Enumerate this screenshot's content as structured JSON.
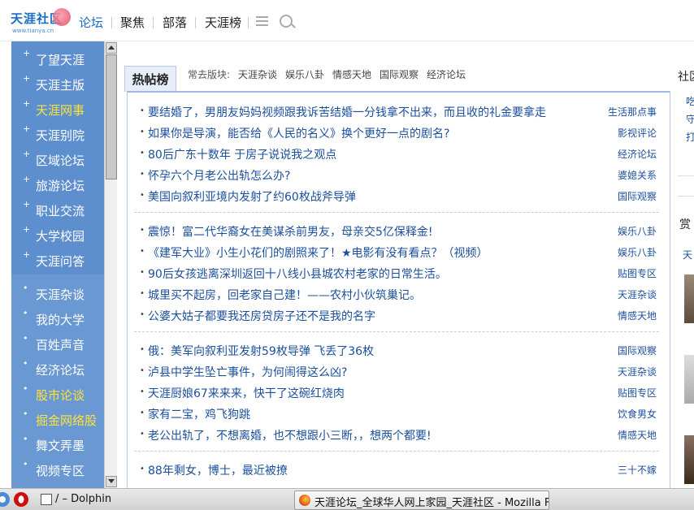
{
  "logo": {
    "text": "天涯社区",
    "url_text": "www.tianya.cn"
  },
  "topnav": [
    "论坛",
    "聚焦",
    "部落",
    "天涯榜"
  ],
  "sidebar": {
    "items": [
      {
        "label": "了望天涯",
        "highlight": false
      },
      {
        "label": "天涯主版",
        "highlight": false
      },
      {
        "label": "天涯网事",
        "highlight": true
      },
      {
        "label": "天涯别院",
        "highlight": false
      },
      {
        "label": "区域论坛",
        "highlight": false
      },
      {
        "label": "旅游论坛",
        "highlight": false
      },
      {
        "label": "职业交流",
        "highlight": false
      },
      {
        "label": "大学校园",
        "highlight": false
      },
      {
        "label": "天涯问答",
        "highlight": false
      }
    ],
    "items2": [
      {
        "label": "天涯杂谈",
        "highlight": false
      },
      {
        "label": "我的大学",
        "highlight": false
      },
      {
        "label": "百姓声音",
        "highlight": false
      },
      {
        "label": "经济论坛",
        "highlight": false
      },
      {
        "label": "股市论谈",
        "highlight": true
      },
      {
        "label": "掘金网络股",
        "highlight": true
      },
      {
        "label": "舞文弄墨",
        "highlight": false
      },
      {
        "label": "视频专区",
        "highlight": false
      }
    ]
  },
  "hot": {
    "tab": "热帖榜",
    "boards_label": "常去版块:",
    "boards": [
      "天涯杂谈",
      "娱乐八卦",
      "情感天地",
      "国际观察",
      "经济论坛"
    ],
    "groups": [
      [
        {
          "title": "要结婚了，男朋友妈妈视频跟我诉苦结婚一分钱拿不出来，而且收的礼金要拿走",
          "cat": "生活那点事"
        },
        {
          "title": "如果你是导演，能否给《人民的名义》换个更好一点的剧名?",
          "cat": "影视评论"
        },
        {
          "title": "80后广东十数年 于房子说说我之观点",
          "cat": "经济论坛"
        },
        {
          "title": "怀孕六个月老公出轨怎么办?",
          "cat": "婆媳关系"
        },
        {
          "title": "美国向叙利亚境内发射了约60枚战斧导弹",
          "cat": "国际观察"
        }
      ],
      [
        {
          "title": "震惊！富二代华裔女在美谋杀前男友，母亲交5亿保释金!",
          "cat": "娱乐八卦"
        },
        {
          "title": "《建军大业》小生小花们的剧照来了！★电影有没有看点？（视频）",
          "cat": "娱乐八卦"
        },
        {
          "title": "90后女孩逃离深圳返回十八线小县城农村老家的日常生活。",
          "cat": "贴图专区"
        },
        {
          "title": "城里买不起房，回老家自己建！——农村小伙筑巢记。",
          "cat": "天涯杂谈"
        },
        {
          "title": "公婆大姑子都要我还房贷房子还不是我的名字",
          "cat": "情感天地"
        }
      ],
      [
        {
          "title": "俄：美军向叙利亚发射59枚导弹 飞丢了36枚",
          "cat": "国际观察"
        },
        {
          "title": "泸县中学生坠亡事件，为何闹得这么凶?",
          "cat": "天涯杂谈"
        },
        {
          "title": "天涯厨娘67来来来，快干了这碗红烧肉",
          "cat": "贴图专区"
        },
        {
          "title": "家有二宝，鸡飞狗跳",
          "cat": "饮食男女"
        },
        {
          "title": "老公出轨了，不想离婚，也不想跟小三断，，想两个都要!",
          "cat": "情感天地"
        }
      ],
      [
        {
          "title": "88年剩女，博士，最近被撩",
          "cat": "三十不嫁"
        }
      ]
    ]
  },
  "rightcol": {
    "head1": "社区",
    "links": [
      "吃",
      "守",
      "打"
    ],
    "head2": "赏",
    "head3": "天"
  },
  "taskbar": {
    "dolphin": "/ – Dolphin",
    "firefox": "天涯论坛_全球华人网上家园_天涯社区 - Mozilla Firefox"
  },
  "colors": {
    "sidebar_bg": "#5d8fcf",
    "highlight": "#ffe23a",
    "link": "#1b4f9c"
  }
}
